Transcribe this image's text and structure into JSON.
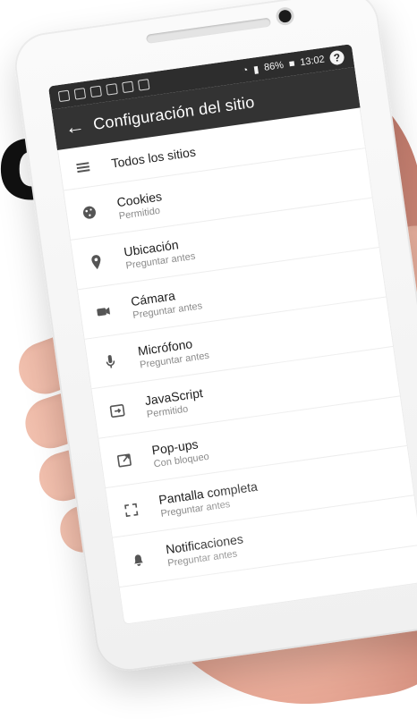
{
  "overlay": {
    "big_letter": "o"
  },
  "device": {
    "status_bar": {
      "battery": "86%",
      "time": "13:02"
    },
    "help_glyph": "?"
  },
  "app": {
    "title": "Configuración del sitio",
    "back_icon": "arrow-left-icon",
    "items": [
      {
        "label": "Todos los sitios",
        "sub": "",
        "icon": "list-icon"
      },
      {
        "label": "Cookies",
        "sub": "Permitido",
        "icon": "cookie-icon"
      },
      {
        "label": "Ubicación",
        "sub": "Preguntar antes",
        "icon": "location-pin-icon"
      },
      {
        "label": "Cámara",
        "sub": "Preguntar antes",
        "icon": "camera-icon"
      },
      {
        "label": "Micrófono",
        "sub": "Preguntar antes",
        "icon": "microphone-icon"
      },
      {
        "label": "JavaScript",
        "sub": "Permitido",
        "icon": "javascript-icon"
      },
      {
        "label": "Pop-ups",
        "sub": "Con bloqueo",
        "icon": "popup-icon"
      },
      {
        "label": "Pantalla completa",
        "sub": "Preguntar antes",
        "icon": "fullscreen-icon"
      },
      {
        "label": "Notificaciones",
        "sub": "Preguntar antes",
        "icon": "bell-icon"
      }
    ]
  }
}
